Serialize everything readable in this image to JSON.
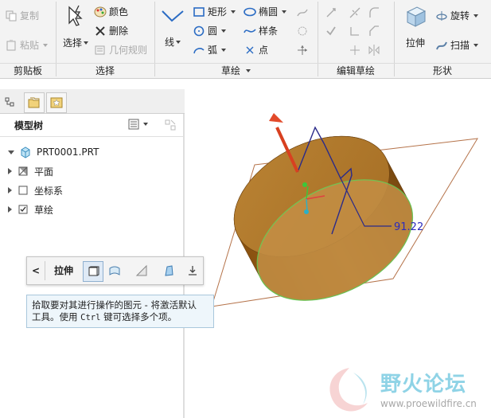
{
  "ribbon": {
    "clipboard": {
      "copy": "复制",
      "paste": "粘贴",
      "label": "剪贴板"
    },
    "select": {
      "select": "选择",
      "color": "颜色",
      "delete": "删除",
      "geometry_rules": "几何规则",
      "label": "选择"
    },
    "sketch": {
      "line": "线",
      "rectangle": "矩形",
      "circle": "圆",
      "arc": "弧",
      "ellipse": "椭圆",
      "spline": "样条",
      "point": "点",
      "label": "草绘"
    },
    "edit_sketch": {
      "label": "编辑草绘"
    },
    "shapes": {
      "extrude": "拉伸",
      "revolve": "旋转",
      "sweep": "扫描",
      "label": "形状"
    }
  },
  "model_tree": {
    "title": "模型树",
    "items": [
      {
        "label": "PRT0001.PRT",
        "expanded": true
      },
      {
        "label": "平面",
        "expanded": false
      },
      {
        "label": "坐标系",
        "expanded": false
      },
      {
        "label": "草绘",
        "expanded": false
      }
    ]
  },
  "minibar": {
    "back": "<",
    "label": "拉伸"
  },
  "tooltip": {
    "line1": "拾取要对其进行操作的图元 - 将激活默认",
    "line2_a": "工具。使用 ",
    "line2_key": "Ctrl",
    "line2_b": " 键可选择多个项。"
  },
  "viewport": {
    "dimension": "91.22",
    "model_color": "#b8792a",
    "edge_color": "#6ad05a"
  },
  "watermark": {
    "text": "野火论坛",
    "url": "www.proewildfire.cn"
  }
}
